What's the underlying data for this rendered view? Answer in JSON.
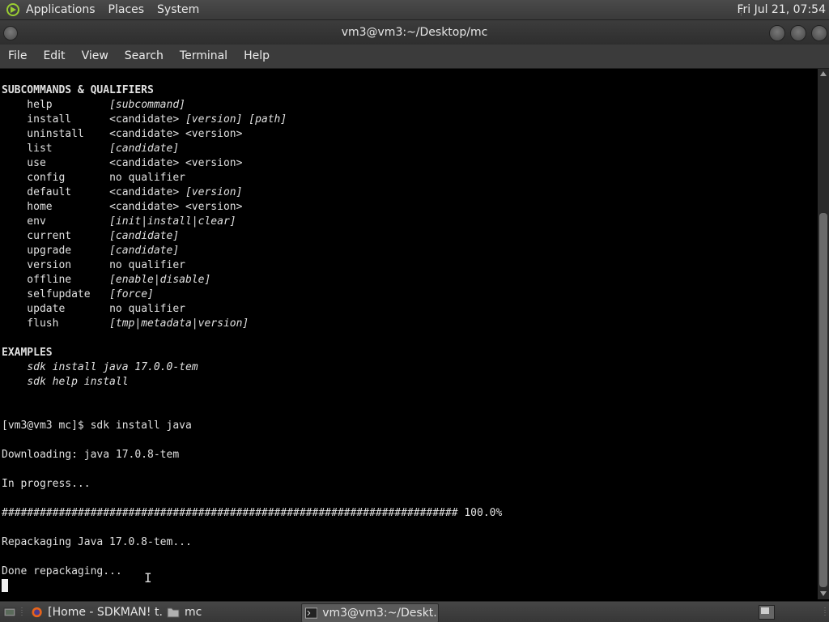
{
  "top_panel": {
    "menus": [
      "Applications",
      "Places",
      "System"
    ],
    "clock": "Fri Jul 21, 07:54"
  },
  "window": {
    "title": "vm3@vm3:~/Desktop/mc",
    "menu": [
      "File",
      "Edit",
      "View",
      "Search",
      "Terminal",
      "Help"
    ]
  },
  "terminal": {
    "section_title": "SUBCOMMANDS & QUALIFIERS",
    "commands": [
      {
        "cmd": "help",
        "qual": "[subcommand]",
        "italic": true
      },
      {
        "cmd": "install",
        "qual": "<candidate> [version] [path]",
        "mixed": [
          "<candidate> ",
          "[version] [path]"
        ]
      },
      {
        "cmd": "uninstall",
        "qual": "<candidate> <version>"
      },
      {
        "cmd": "list",
        "qual": "[candidate]",
        "italic": true
      },
      {
        "cmd": "use",
        "qual": "<candidate> <version>"
      },
      {
        "cmd": "config",
        "qual": "no qualifier"
      },
      {
        "cmd": "default",
        "qual": "<candidate> [version]",
        "mixed": [
          "<candidate> ",
          "[version]"
        ]
      },
      {
        "cmd": "home",
        "qual": "<candidate> <version>"
      },
      {
        "cmd": "env",
        "qual": "[init|install|clear]",
        "italic": true
      },
      {
        "cmd": "current",
        "qual": "[candidate]",
        "italic": true
      },
      {
        "cmd": "upgrade",
        "qual": "[candidate]",
        "italic": true
      },
      {
        "cmd": "version",
        "qual": "no qualifier"
      },
      {
        "cmd": "offline",
        "qual": "[enable|disable]",
        "italic": true
      },
      {
        "cmd": "selfupdate",
        "qual": "[force]",
        "italic": true
      },
      {
        "cmd": "update",
        "qual": "no qualifier"
      },
      {
        "cmd": "flush",
        "qual": "[tmp|metadata|version]",
        "italic": true
      }
    ],
    "examples_title": "EXAMPLES",
    "examples": [
      "sdk install java 17.0.0-tem",
      "sdk help install"
    ],
    "prompt": "[vm3@vm3 mc]$ sdk install java",
    "downloading": "Downloading: java 17.0.8-tem",
    "in_progress": "In progress...",
    "progress_bar": "######################################################################## 100.0%",
    "repackaging": "Repackaging Java 17.0.8-tem...",
    "done": "Done repackaging..."
  },
  "taskbar": {
    "tasks": [
      {
        "label": "[Home - SDKMAN! t...",
        "icon": "firefox-icon",
        "active": false
      },
      {
        "label": "mc",
        "icon": "folder-icon",
        "active": false
      },
      {
        "label": "vm3@vm3:~/Deskt...",
        "icon": "terminal-icon",
        "active": true
      }
    ]
  }
}
